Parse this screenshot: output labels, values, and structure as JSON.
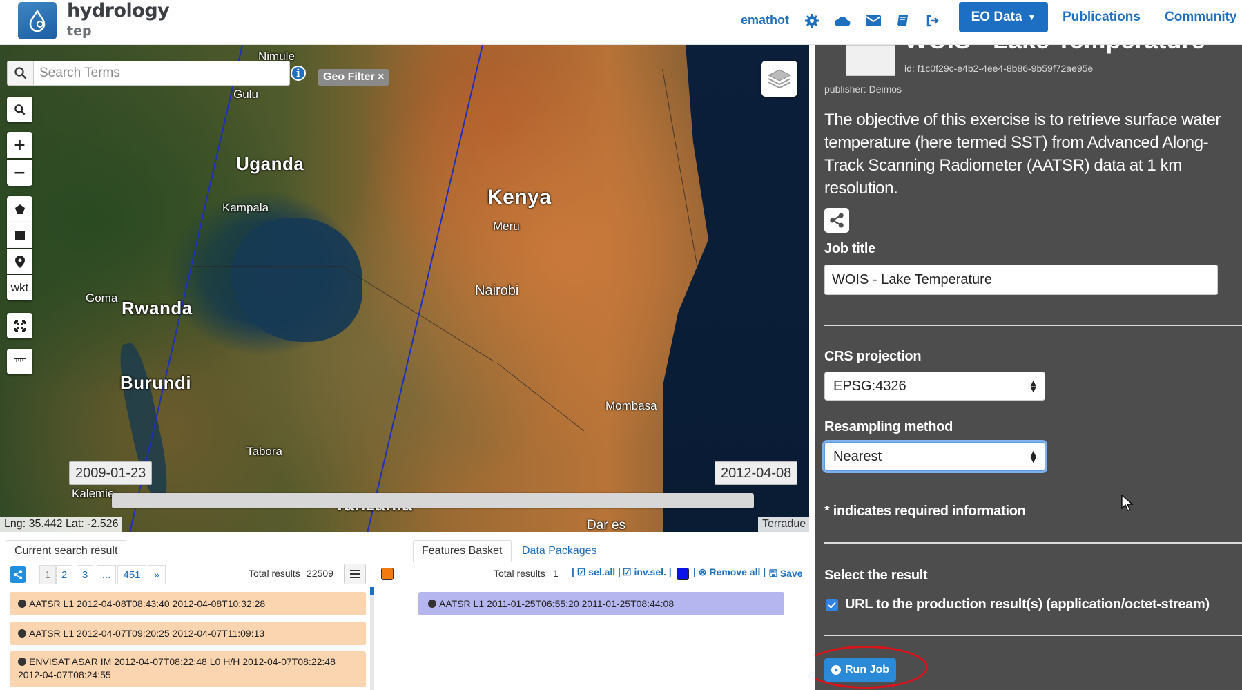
{
  "navbar": {
    "logo_main": "hydrology",
    "logo_sub": "tep",
    "username": "emathot",
    "eo_data_label": "EO Data",
    "publications_label": "Publications",
    "community_label": "Community"
  },
  "map": {
    "search_placeholder": "Search Terms",
    "geo_filter_label": "Geo Filter ×",
    "wkt_label": "wkt",
    "date_start": "2009-01-23",
    "date_end": "2012-04-08",
    "coords": "Lng: 35.442 Lat: -2.526",
    "credit": "Terradue",
    "places": {
      "nimule": "Nimule",
      "gulu": "Gulu",
      "uganda": "Uganda",
      "kampala": "Kampala",
      "kenya": "Kenya",
      "meru": "Meru",
      "nairobi": "Nairobi",
      "goma": "Goma",
      "rwanda": "Rwanda",
      "burundi": "Burundi",
      "mombasa": "Mombasa",
      "tabora": "Tabora",
      "kalemie": "Kalemie",
      "tanzania": "Tanzania",
      "dar_es": "Dar es"
    }
  },
  "search_results": {
    "tab_label": "Current search result",
    "pages": [
      "1",
      "2",
      "3",
      "...",
      "451",
      "»"
    ],
    "total_label": "Total results",
    "total_value": "22509",
    "items": [
      "AATSR L1 2012-04-08T08:43:40 2012-04-08T10:32:28",
      "AATSR L1 2012-04-07T09:20:25 2012-04-07T11:09:13",
      "ENVISAT ASAR IM 2012-04-07T08:22:48 L0 H/H 2012-04-07T08:22:48 2012-04-07T08:24:55"
    ]
  },
  "basket": {
    "tab_features": "Features Basket",
    "tab_packages": "Data Packages",
    "total_label": "Total results",
    "total_value": "1",
    "sel_all": "sel.all",
    "inv_sel": "inv.sel.",
    "remove_all": "Remove all",
    "save": "Save",
    "items": [
      "AATSR L1 2011-01-25T06:55:20 2011-01-25T08:44:08"
    ]
  },
  "panel": {
    "title": "WOIS - Lake Temperature",
    "id": "id: f1c0f29c-e4b2-4ee4-8b86-9b59f72ae95e",
    "publisher": "publisher: Deimos",
    "description": "The objective of this exercise is to retrieve surface water temperature (here termed SST) from Advanced Along-Track Scanning Radiometer (AATSR) data at 1 km resolution.",
    "job_title_label": "Job title",
    "job_title_value": "WOIS - Lake Temperature",
    "crs_label": "CRS projection",
    "crs_value": "EPSG:4326",
    "resampling_label": "Resampling method",
    "resampling_value": "Nearest",
    "required_note": "* indicates required information",
    "select_result_label": "Select the result",
    "result_option": "URL to the production result(s) (application/octet-stream)",
    "run_job_label": "Run Job"
  },
  "colors": {
    "primary": "#1c6fc2",
    "panel_bg": "#4d4d4d",
    "result_row": "#fbd5b0",
    "basket_row": "#b5b5f0",
    "highlight": "#d9141b"
  }
}
